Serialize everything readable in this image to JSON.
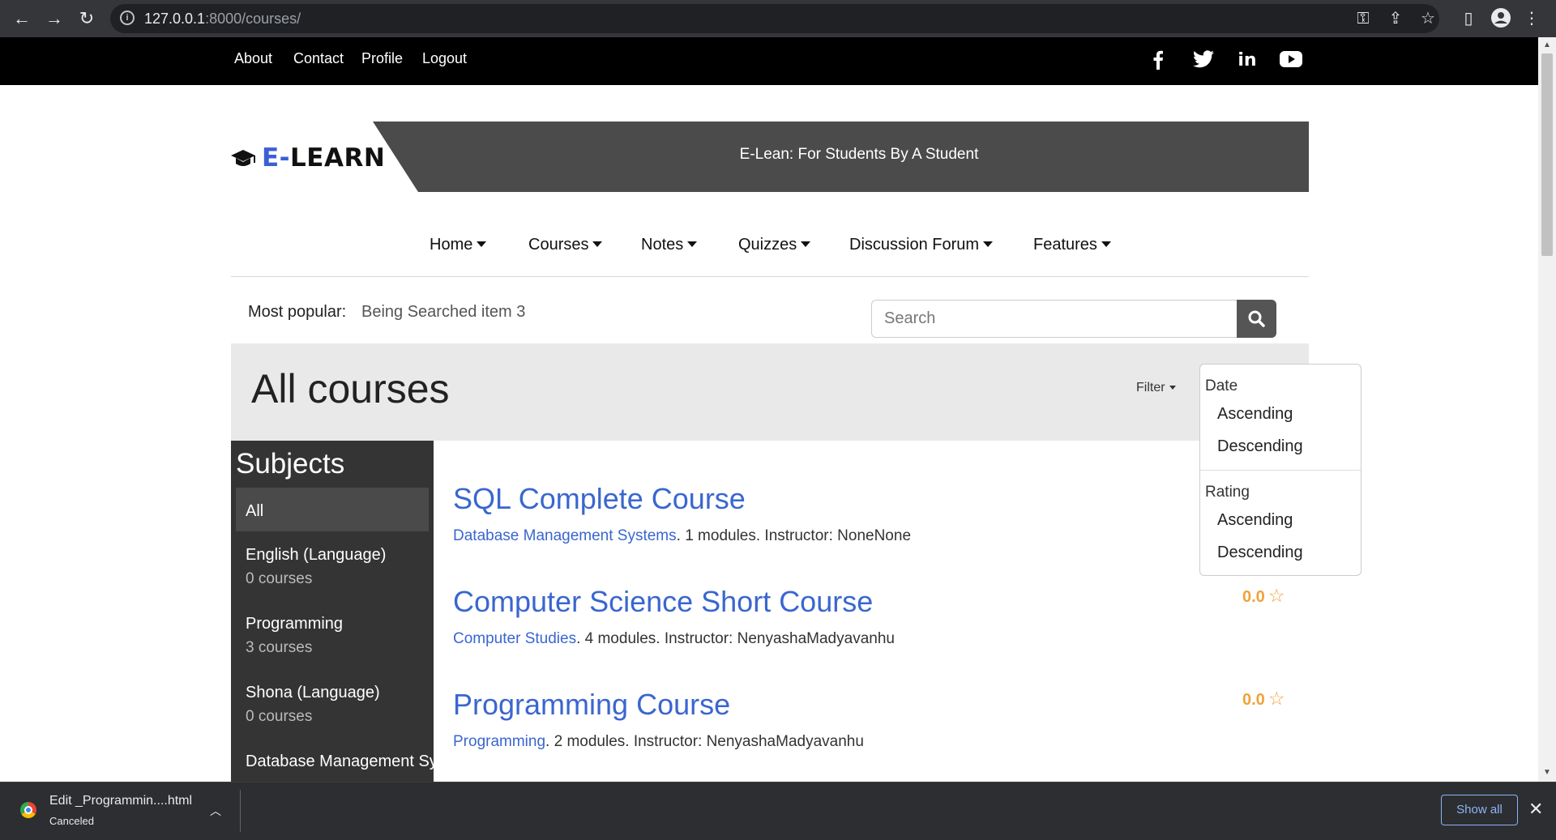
{
  "browser": {
    "url_host": "127.0.0.1",
    "url_rest": ":8000/courses/",
    "back_icon": "←",
    "forward_icon": "→",
    "reload_icon": "↻"
  },
  "topbar": {
    "links": [
      "About",
      "Contact",
      "Profile",
      "Logout"
    ],
    "social": [
      "f",
      "🐦",
      "in",
      "▶"
    ]
  },
  "header": {
    "logo_e": "E-",
    "logo_rest": "LEARN",
    "tagline": "E-Lean: For Students By A Student"
  },
  "nav": [
    "Home",
    "Courses",
    "Notes",
    "Quizzes",
    "Discussion Forum",
    "Features"
  ],
  "popular": {
    "label": "Most popular:",
    "item": "Being Searched item 3"
  },
  "search": {
    "placeholder": "Search"
  },
  "page": {
    "title": "All courses",
    "filter_label": "Filter"
  },
  "filter_menu": {
    "date_header": "Date",
    "date_asc": "Ascending",
    "date_desc": "Descending",
    "rating_header": "Rating",
    "rating_asc": "Ascending",
    "rating_desc": "Descending"
  },
  "sidebar": {
    "title": "Subjects",
    "all_label": "All",
    "subjects": [
      {
        "name": "English (Language)",
        "count": "0 courses"
      },
      {
        "name": "Programming",
        "count": "3 courses"
      },
      {
        "name": "Shona (Language)",
        "count": "0 courses"
      },
      {
        "name": "Database Management Systems",
        "count": ""
      }
    ]
  },
  "courses": [
    {
      "title": "SQL Complete Course",
      "subject": "Database Management Systems",
      "details": ". 1 modules. Instructor: NoneNone",
      "rating": ""
    },
    {
      "title": "Computer Science Short Course",
      "subject": "Computer Studies",
      "details": ". 4 modules. Instructor: NenyashaMadyavanhu",
      "rating": "0.0"
    },
    {
      "title": "Programming Course",
      "subject": "Programming",
      "details": ". 2 modules. Instructor: NenyashaMadyavanhu",
      "rating": "0.0"
    }
  ],
  "download": {
    "filename": "Edit _Programmin....html",
    "status": "Canceled",
    "show_all": "Show all"
  }
}
